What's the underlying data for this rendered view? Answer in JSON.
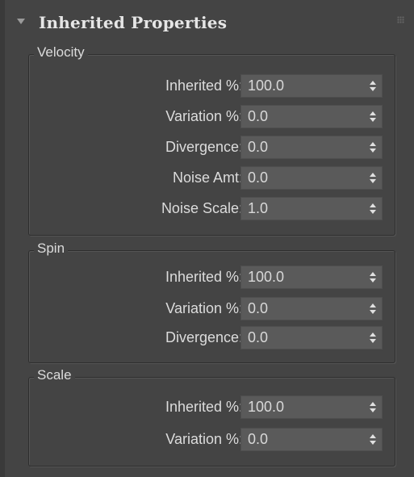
{
  "panel": {
    "title": "Inherited Properties"
  },
  "groups": [
    {
      "name": "Velocity",
      "fields": [
        {
          "label": "Inherited %:",
          "value": "100.0"
        },
        {
          "label": "Variation %:",
          "value": "0.0"
        },
        {
          "label": "Divergence:",
          "value": "0.0"
        },
        {
          "label": "Noise Amt:",
          "value": "0.0"
        },
        {
          "label": "Noise Scale:",
          "value": "1.0"
        }
      ]
    },
    {
      "name": "Spin",
      "fields": [
        {
          "label": "Inherited %:",
          "value": "100.0"
        },
        {
          "label": "Variation %:",
          "value": "0.0"
        },
        {
          "label": "Divergence:",
          "value": "0.0"
        }
      ]
    },
    {
      "name": "Scale",
      "fields": [
        {
          "label": "Inherited %:",
          "value": "100.0"
        },
        {
          "label": "Variation %:",
          "value": "0.0"
        }
      ]
    }
  ]
}
